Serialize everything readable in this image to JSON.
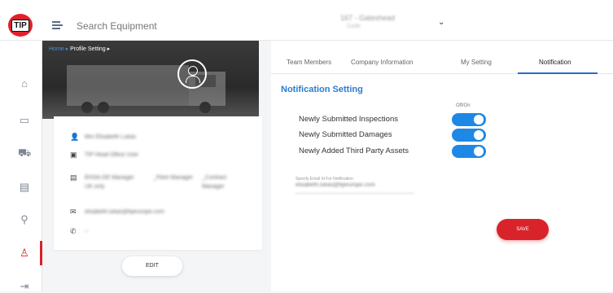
{
  "app": {
    "logo_text": "TIP",
    "search_placeholder": "Search Equipment",
    "depot_name": "167 - Gateshead",
    "depot_sub": "Code"
  },
  "sidebar": {
    "items": [
      {
        "name": "home-icon",
        "glyph": "⌂"
      },
      {
        "name": "trailer-icon",
        "glyph": "▭"
      },
      {
        "name": "truck-icon",
        "glyph": "⛟"
      },
      {
        "name": "report-icon",
        "glyph": "▤"
      },
      {
        "name": "inspection-icon",
        "glyph": "⚲"
      },
      {
        "name": "user-icon",
        "glyph": "♙"
      },
      {
        "name": "logout-icon",
        "glyph": "⇥"
      }
    ]
  },
  "breadcrumb": {
    "home": "Home ▸",
    "current": "Profile Setting ▸"
  },
  "profile": {
    "name": "Mrs Elisabeth Lukas",
    "office": "TIP Head Office User",
    "role_line1": "EHSA-DE Manager  UK only",
    "role_col2": "_Fleet Manager",
    "role_col3": "_Contract Manager",
    "email": "elisabeth.lukas@tipeurope.com",
    "phone": "--",
    "edit_label": "EDIT"
  },
  "tabs": [
    {
      "label": "Team Members"
    },
    {
      "label": "Company Information"
    },
    {
      "label": "My Setting"
    },
    {
      "label": "Notification"
    }
  ],
  "notification": {
    "title": "Notification Setting",
    "offon_label": "Off/On",
    "rows": [
      {
        "label": "Newly Submitted Inspections",
        "enabled": true
      },
      {
        "label": "Newly Submitted Damages",
        "enabled": true
      },
      {
        "label": "Newly Added Third Party Assets",
        "enabled": true
      }
    ],
    "email_label": "Specify Email Id For Notification",
    "email_value": "elisabeth.lukas@tipeurope.com",
    "save_label": "SAVE"
  },
  "colors": {
    "brand_red": "#d8232a",
    "accent_blue": "#2b7bd3",
    "toggle_blue": "#1e88e5"
  }
}
